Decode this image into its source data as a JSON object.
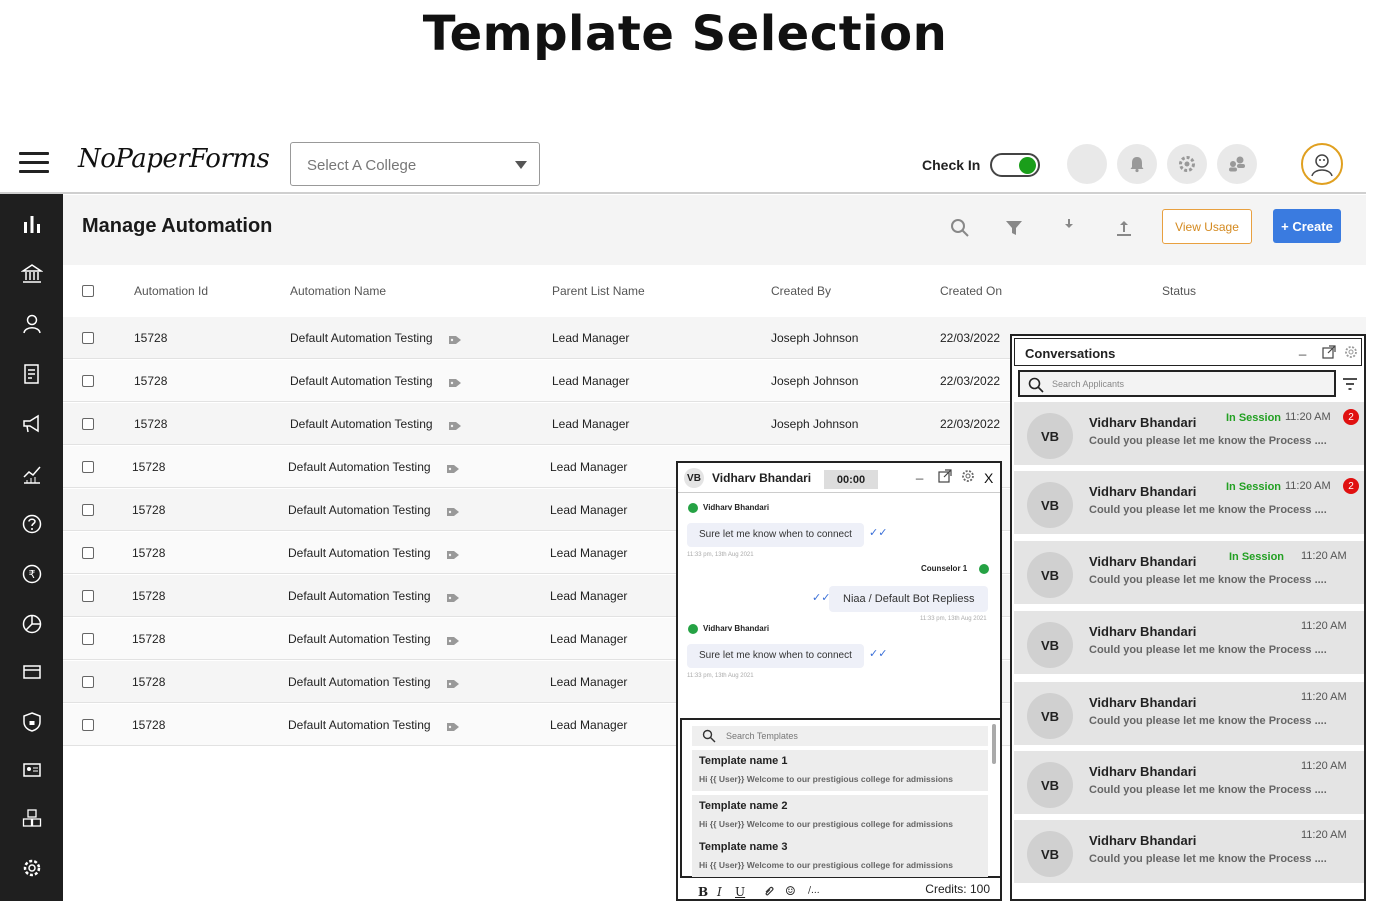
{
  "page_heading": "Template Selection",
  "topbar": {
    "logo": "NoPaperForms",
    "college_select_placeholder": "Select A College",
    "checkin_label": "Check In"
  },
  "content": {
    "title": "Manage Automation",
    "view_usage_label": "View Usage",
    "create_label": "+ Create"
  },
  "table": {
    "headers": [
      "Automation Id",
      "Automation Name",
      "Parent List Name",
      "Created By",
      "Created On",
      "Status"
    ],
    "rows": [
      {
        "id": "15728",
        "name": "Default Automation Testing",
        "parent": "Lead Manager",
        "created_by": "Joseph Johnson",
        "created_on": "22/03/2022"
      },
      {
        "id": "15728",
        "name": "Default Automation Testing",
        "parent": "Lead Manager",
        "created_by": "Joseph Johnson",
        "created_on": "22/03/2022"
      },
      {
        "id": "15728",
        "name": "Default Automation Testing",
        "parent": "Lead Manager",
        "created_by": "Joseph Johnson",
        "created_on": "22/03/2022"
      },
      {
        "id": "15728",
        "name": "Default Automation Testing",
        "parent": "Lead Manager"
      },
      {
        "id": "15728",
        "name": "Default Automation Testing",
        "parent": "Lead Manager"
      },
      {
        "id": "15728",
        "name": "Default Automation Testing",
        "parent": "Lead Manager"
      },
      {
        "id": "15728",
        "name": "Default Automation Testing",
        "parent": "Lead Manager"
      },
      {
        "id": "15728",
        "name": "Default Automation Testing",
        "parent": "Lead Manager"
      },
      {
        "id": "15728",
        "name": "Default Automation Testing",
        "parent": "Lead Manager"
      },
      {
        "id": "15728",
        "name": "Default Automation Testing",
        "parent": "Lead Manager"
      }
    ]
  },
  "chat": {
    "initials": "VB",
    "name": "Vidharv Bhandari",
    "timer": "00:00",
    "close_label": "X",
    "messages": [
      {
        "sender": "Vidharv Bhandari",
        "text": "Sure let me know when to connect",
        "time": "11:33 pm, 13th Aug 2021"
      },
      {
        "sender": "Counselor 1",
        "text": "Niaa / Default Bot Repliess",
        "time": "11:33 pm, 13th Aug 2021"
      },
      {
        "sender": "Vidharv Bhandari",
        "text": "Sure let me know when to connect",
        "time": "11:33 pm, 13th Aug 2021"
      }
    ],
    "template_search_placeholder": "Search Templates",
    "templates": [
      {
        "name": "Template name 1",
        "text": "Hi {{ User}} Welcome to our prestigious college for admissions"
      },
      {
        "name": "Template name 2",
        "text": "Hi {{ User}} Welcome to our prestigious college for admissions"
      },
      {
        "name": "Template name 3",
        "text": "Hi {{ User}} Welcome to our prestigious college for admissions"
      }
    ],
    "format_bold": "B",
    "format_italic": "I",
    "format_underline": "U",
    "format_slash": "/...",
    "credits": "Credits: 100"
  },
  "conversations": {
    "title": "Conversations",
    "search_placeholder": "Search Applicants",
    "items": [
      {
        "initials": "VB",
        "name": "Vidharv Bhandari",
        "message": "Could you please let me know the Process ....",
        "status": "In Session",
        "time": "11:20 AM",
        "badge": "2"
      },
      {
        "initials": "VB",
        "name": "Vidharv Bhandari",
        "message": "Could you please let me know the Process ....",
        "status": "In Session",
        "time": "11:20 AM",
        "badge": "2"
      },
      {
        "initials": "VB",
        "name": "Vidharv Bhandari",
        "message": "Could you please let me know the Process ....",
        "status": "In Session",
        "time": "11:20 AM"
      },
      {
        "initials": "VB",
        "name": "Vidharv Bhandari",
        "message": "Could you please let me know the Process ....",
        "time": "11:20 AM"
      },
      {
        "initials": "VB",
        "name": "Vidharv Bhandari",
        "message": "Could you please let me know the Process ....",
        "time": "11:20 AM"
      },
      {
        "initials": "VB",
        "name": "Vidharv Bhandari",
        "message": "Could you please let me know the Process ....",
        "time": "11:20 AM"
      },
      {
        "initials": "VB",
        "name": "Vidharv Bhandari",
        "message": "Could you please let me know the Process ....",
        "time": "11:20 AM"
      }
    ]
  },
  "icons": {
    "sidebar": [
      "bar-chart-icon",
      "institution-icon",
      "user-icon",
      "form-icon",
      "megaphone-icon",
      "analytics-icon",
      "help-icon",
      "rupee-icon",
      "pie-chart-icon",
      "card-icon",
      "shield-icon",
      "id-card-icon",
      "boxes-icon",
      "gear-icon"
    ]
  },
  "colors": {
    "accent": "#3a7be0",
    "usage_border": "#e8a040",
    "session_green": "#22a022",
    "badge_red": "#e01010",
    "sidebar_bg": "#1f1f1f"
  }
}
